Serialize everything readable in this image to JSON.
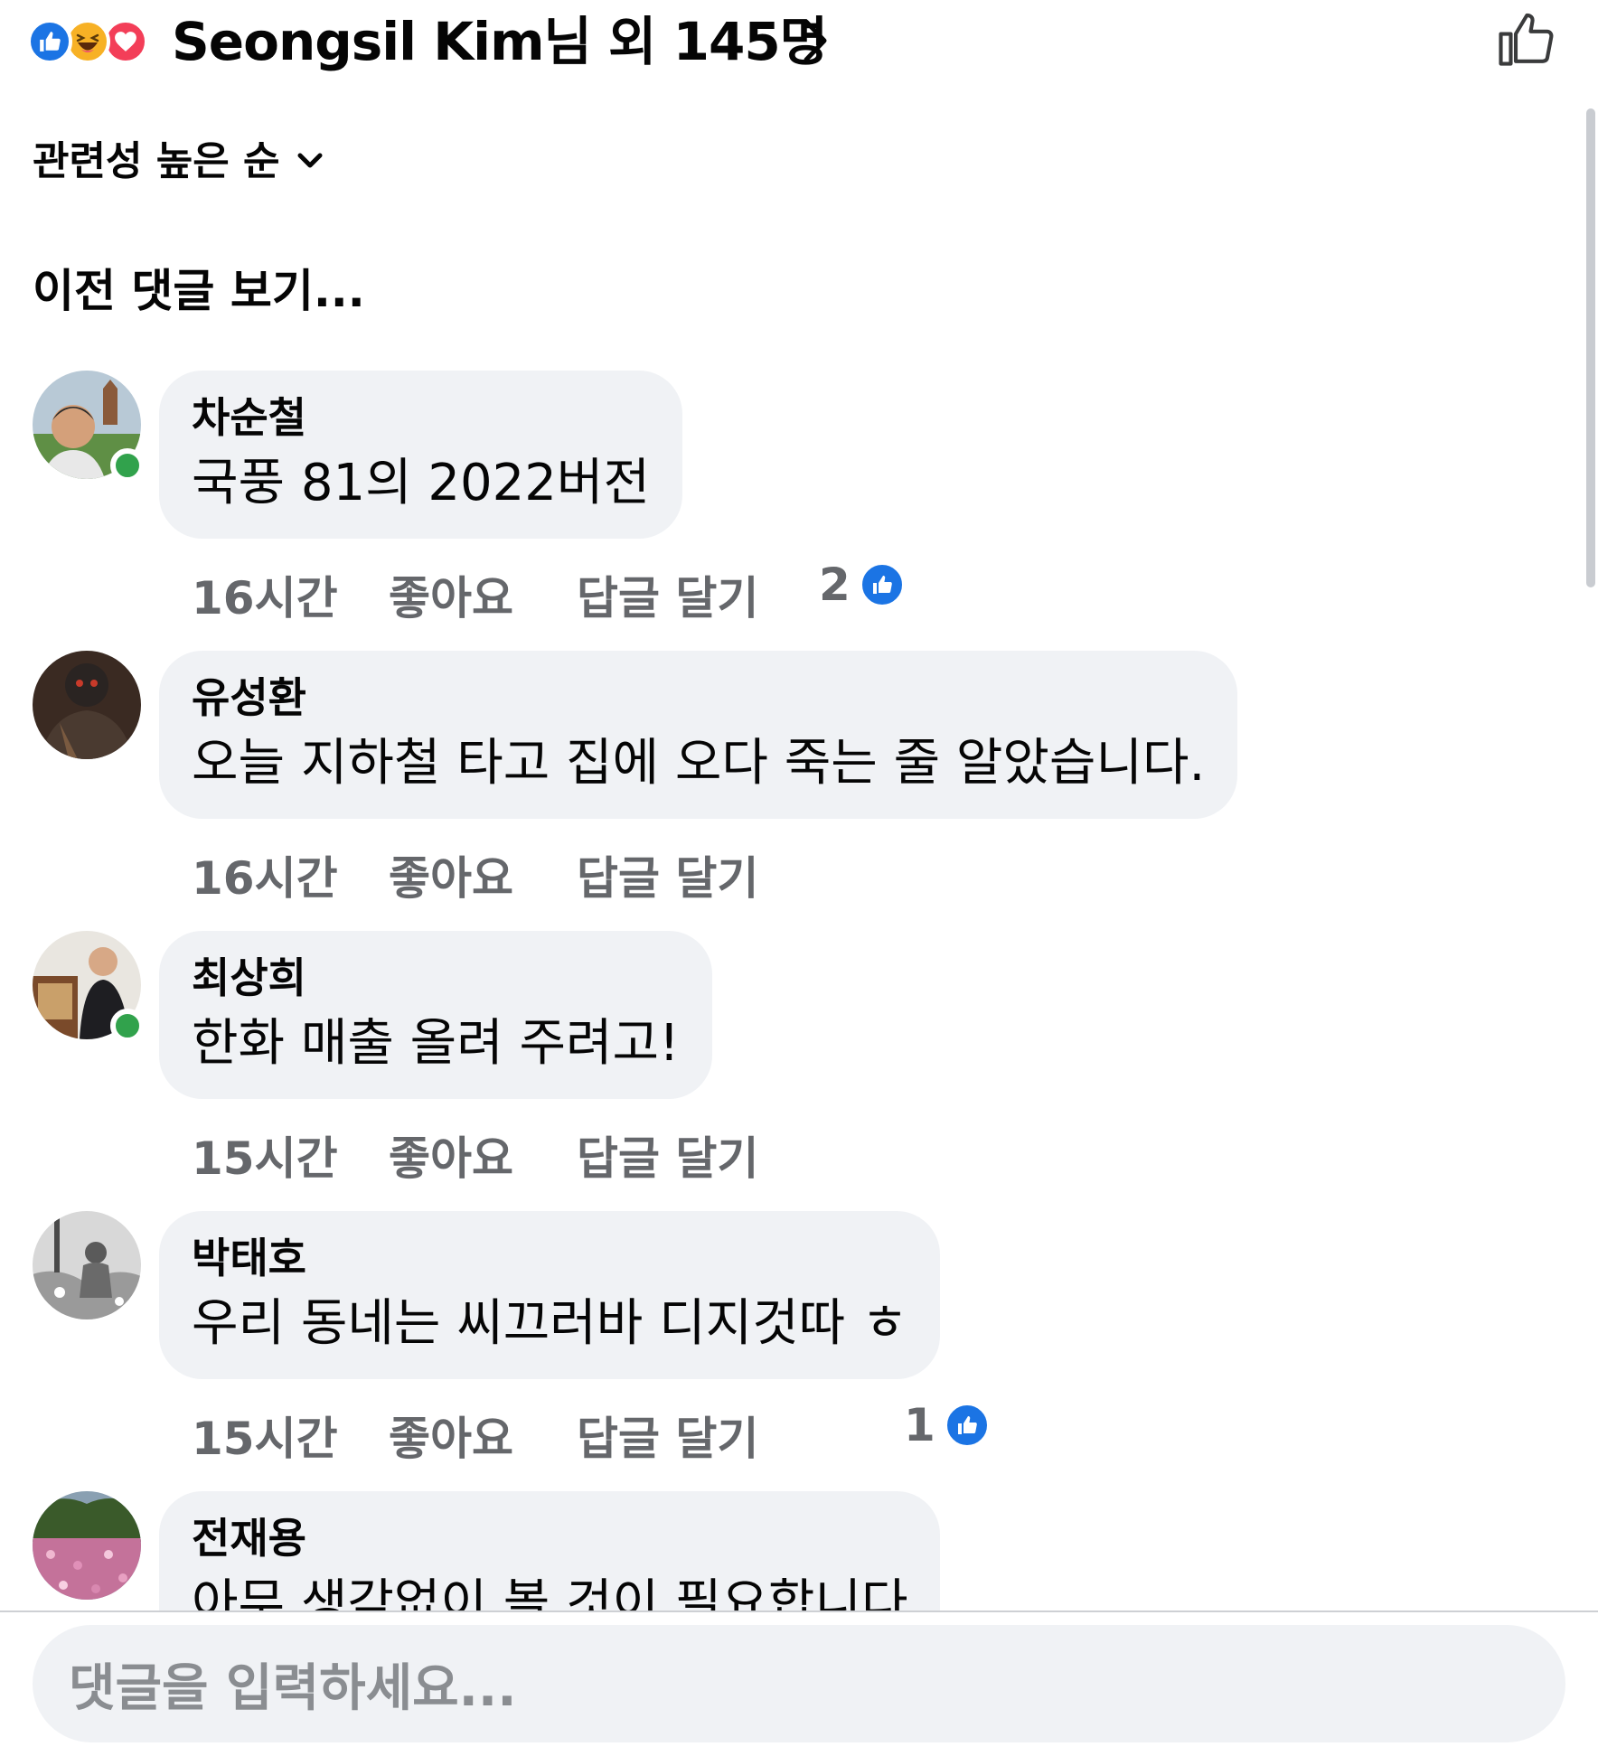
{
  "header": {
    "reactions": [
      "like-reaction",
      "haha-reaction",
      "love-reaction"
    ],
    "summary": "Seongsil Kim님 외 145명",
    "chevron_icon": "chevron-right-icon",
    "like_icon": "thumbs-up-outline-icon"
  },
  "sort": {
    "label": "관련성 높은 순",
    "icon": "chevron-down-icon"
  },
  "previous_comments": "이전 댓글 보기...",
  "comments": [
    {
      "name": "차순철",
      "text": "국풍 81의 2022버전",
      "time": "16시간",
      "like": "좋아요",
      "reply": "답글 달기",
      "likes": "2",
      "online": true
    },
    {
      "name": "유성환",
      "text": "오늘 지하철 타고 집에 오다 죽는 줄 알았습니다.",
      "time": "16시간",
      "like": "좋아요",
      "reply": "답글 달기",
      "likes": "",
      "online": false
    },
    {
      "name": "최상희",
      "text": "한화 매출 올려 주려고!",
      "time": "15시간",
      "like": "좋아요",
      "reply": "답글 달기",
      "likes": "",
      "online": true
    },
    {
      "name": "박태호",
      "text": "우리 동네는 씨끄러바 디지것따 ㅎ",
      "time": "15시간",
      "like": "좋아요",
      "reply": "답글 달기",
      "likes": "1",
      "online": false
    },
    {
      "name": "전재용",
      "text": "아무 생각없이 볼 것이 필요합니다",
      "time": "",
      "like": "",
      "reply": "",
      "likes": "",
      "online": false
    }
  ],
  "composer": {
    "placeholder": "댓글을 입력하세요..."
  },
  "colors": {
    "accent": "#1b74e4",
    "bubble": "#f0f2f5",
    "meta": "#65676b",
    "online": "#31a24c"
  }
}
